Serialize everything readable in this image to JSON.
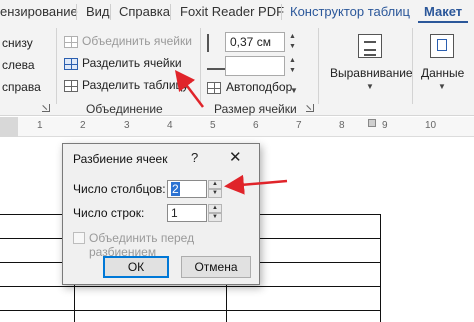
{
  "ribbon_tabs": [
    "ензирование",
    "Вид",
    "Справка",
    "Foxit Reader PDF",
    "Конструктор таблиц",
    "Макет"
  ],
  "ribbon": {
    "insert_items": [
      "снизу",
      "слева",
      "справа"
    ],
    "merge_group": {
      "label": "Объединение",
      "merge_cells": "Объединить ячейки",
      "split_cells": "Разделить ячейки",
      "split_table": "Разделить таблицу"
    },
    "cell_size_group": {
      "label": "Размер ячейки",
      "height_value": "0,37 см",
      "autofit": "Автоподбор"
    },
    "alignment": "Выравнивание",
    "data": "Данные"
  },
  "ruler_numbers": [
    "1",
    "2",
    "3",
    "4",
    "5",
    "6",
    "7",
    "8",
    "9",
    "10"
  ],
  "dialog": {
    "title": "Разбиение ячеек",
    "help": "?",
    "close": "✕",
    "columns_label": "Число столбцов:",
    "columns_value": "2",
    "rows_label": "Число строк:",
    "rows_value": "1",
    "merge_before_split": "Объединить перед разбиением",
    "ok": "ОК",
    "cancel": "Отмена"
  },
  "annotation_color": "#e0242a",
  "accent_color": "#2b579a"
}
